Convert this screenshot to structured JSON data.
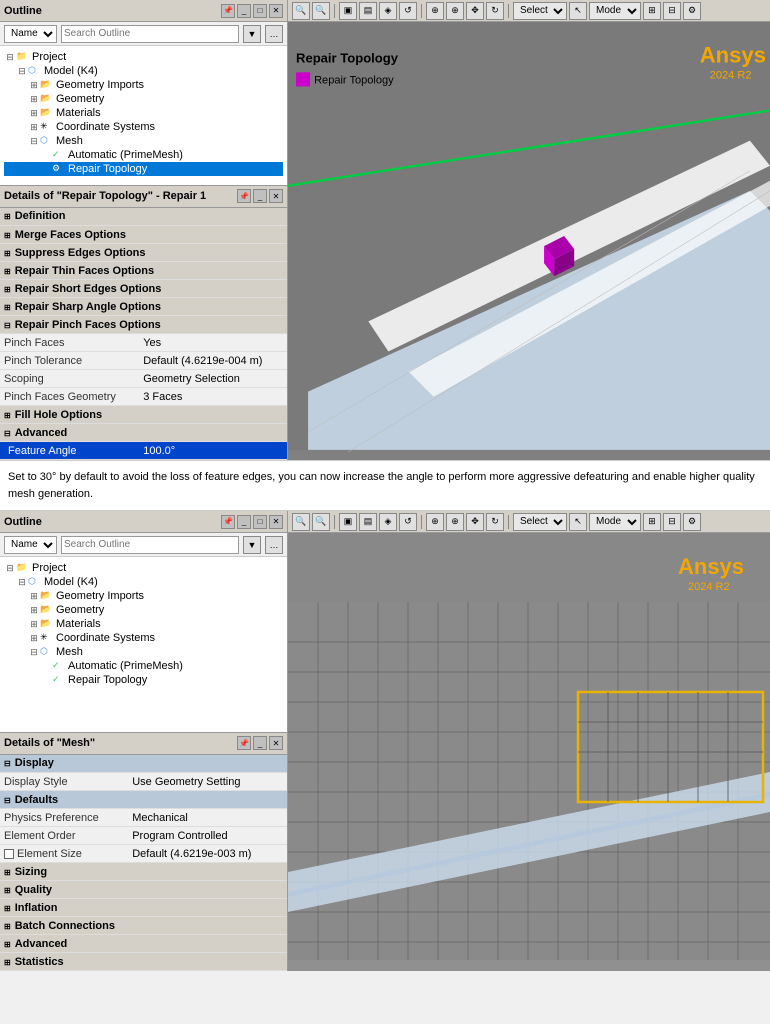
{
  "top": {
    "outline_title": "Outline",
    "viewport_title": "Repair Topology",
    "legend_label": "Repair Topology",
    "ansys_text": "Ansys",
    "ansys_version": "2024 R2",
    "tree": {
      "project": "Project",
      "model": "Model (K4)",
      "geometry_imports": "Geometry Imports",
      "geometry": "Geometry",
      "materials": "Materials",
      "coordinate_systems": "Coordinate Systems",
      "mesh": "Mesh",
      "automatic": "Automatic (PrimeMesh)",
      "repair_topology": "Repair Topology"
    },
    "details_title": "Details of \"Repair Topology\" - Repair 1",
    "sections": {
      "definition": "Definition",
      "merge_faces": "Merge Faces Options",
      "suppress_edges": "Suppress Edges Options",
      "repair_thin": "Repair Thin Faces Options",
      "repair_short": "Repair Short Edges Options",
      "repair_sharp": "Repair Sharp Angle Options",
      "repair_pinch": "Repair Pinch Faces Options",
      "fill_hole": "Fill Hole Options",
      "advanced": "Advanced"
    },
    "pinch_props": {
      "pinch_faces_label": "Pinch Faces",
      "pinch_faces_value": "Yes",
      "pinch_tolerance_label": "Pinch Tolerance",
      "pinch_tolerance_value": "Default (4.6219e-004 m)",
      "scoping_label": "Scoping",
      "scoping_value": "Geometry Selection",
      "pinch_faces_geometry_label": "Pinch Faces Geometry",
      "pinch_faces_geometry_value": "3 Faces"
    },
    "advanced_props": {
      "feature_angle_label": "Feature Angle",
      "feature_angle_value": "100.0°"
    }
  },
  "middle_text": "Set to 30° by default to avoid the loss of feature edges, you can now increase the angle to perform more aggressive defeaturing and enable higher quality mesh generation.",
  "bottom": {
    "outline_title": "Outline",
    "ansys_text": "Ansys",
    "ansys_version": "2024 R2",
    "tree": {
      "project": "Project",
      "model": "Model (K4)",
      "geometry_imports": "Geometry Imports",
      "geometry": "Geometry",
      "materials": "Materials",
      "coordinate_systems": "Coordinate Systems",
      "mesh": "Mesh",
      "automatic": "Automatic (PrimeMesh)",
      "repair_topology": "Repair Topology"
    },
    "details_title": "Details of \"Mesh\"",
    "sections": {
      "display": "Display",
      "defaults": "Defaults",
      "sizing": "Sizing",
      "quality": "Quality",
      "inflation": "Inflation",
      "batch_connections": "Batch Connections",
      "advanced": "Advanced",
      "statistics": "Statistics"
    },
    "display_props": {
      "display_style_label": "Display Style",
      "display_style_value": "Use Geometry Setting"
    },
    "defaults_props": {
      "physics_label": "Physics Preference",
      "physics_value": "Mechanical",
      "element_order_label": "Element Order",
      "element_order_value": "Program Controlled",
      "element_size_label": "Element Size",
      "element_size_value": "Default (4.6219e-003 m)"
    }
  },
  "toolbar": {
    "select_label": "Select",
    "mode_label": "Mode"
  }
}
